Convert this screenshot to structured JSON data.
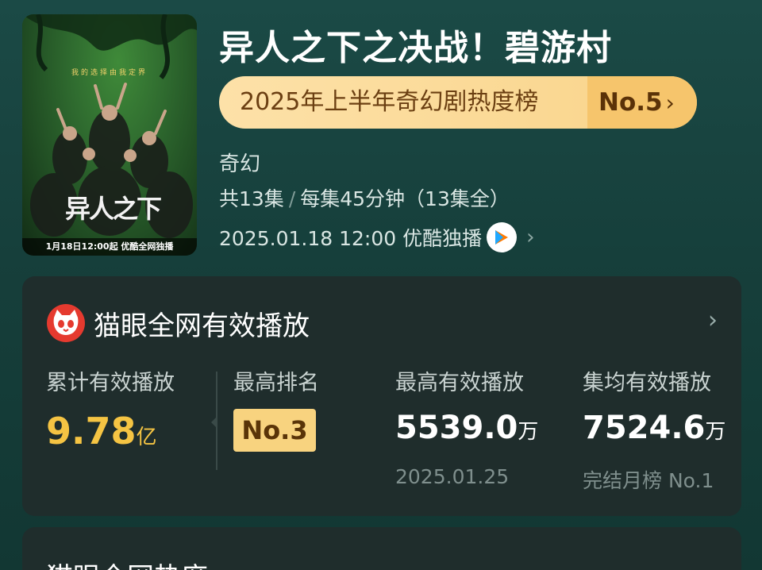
{
  "show": {
    "title": "异人之下之决战！碧游村",
    "rank_label": "2025年上半年奇幻剧热度榜",
    "rank_value": "No.5",
    "genre": "奇幻",
    "episodes": "共13集",
    "duration": "每集45分钟（13集全）",
    "release": "2025.01.18 12:00 优酷独播",
    "platform_icon": "youku-icon"
  },
  "poster": {
    "tagline": "我的选择由我定界",
    "logo_text": "异人之下",
    "bottom_text": "1月18日12:00起 优酷全网独播"
  },
  "maoyan": {
    "title": "猫眼全网有效播放",
    "icon": "maoyan-cat-icon",
    "stats": {
      "total_label": "累计有效播放",
      "total_value": "9.78",
      "total_unit": "亿",
      "best_rank_label": "最高排名",
      "best_rank_value": "No.3",
      "peak_label": "最高有效播放",
      "peak_value": "5539.0",
      "peak_unit": "万",
      "peak_date": "2025.01.25",
      "avg_label": "集均有效播放",
      "avg_value": "7524.6",
      "avg_unit": "万",
      "avg_note": "完结月榜 No.1"
    }
  },
  "next_card": {
    "title": "猫眼全网热度"
  },
  "colors": {
    "accent_yellow": "#f5c443",
    "rank_pill": "#fde1a8",
    "card_bg": "#1f2d2c"
  }
}
